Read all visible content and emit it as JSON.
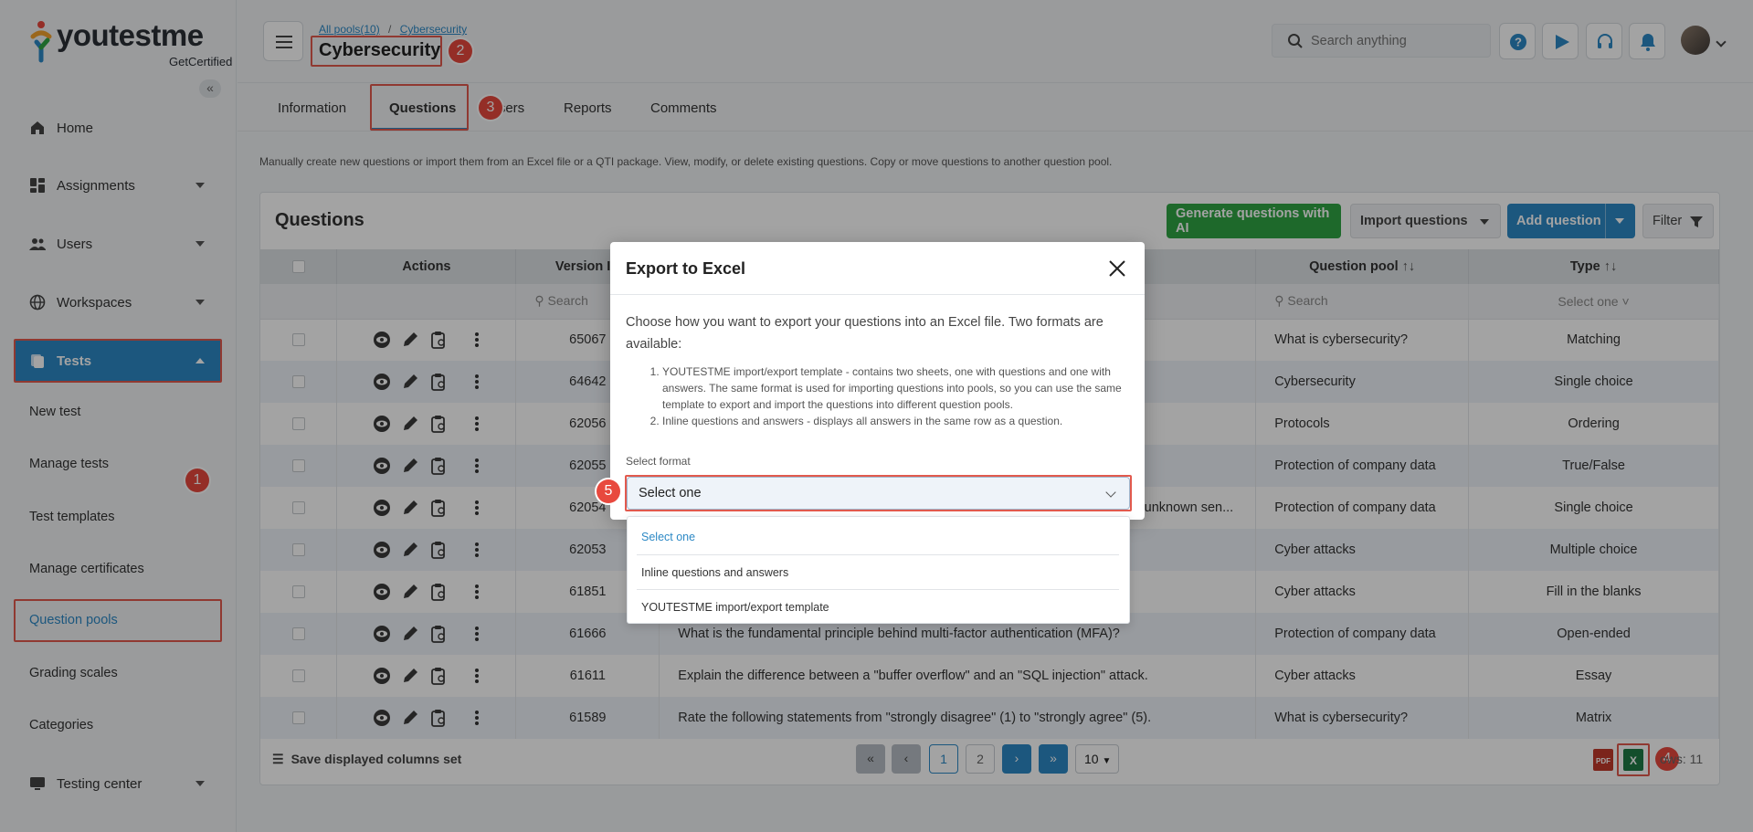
{
  "app": {
    "logo_text": "youtestme",
    "logo_sub": "GetCertified"
  },
  "sidebar": {
    "nav": [
      {
        "label": "Home",
        "icon": "home-icon"
      },
      {
        "label": "Assignments",
        "icon": "dashboard-icon"
      },
      {
        "label": "Users",
        "icon": "users-icon"
      },
      {
        "label": "Workspaces",
        "icon": "globe-icon"
      },
      {
        "label": "Tests",
        "icon": "tests-icon"
      }
    ],
    "sub_items": [
      "New test",
      "Manage tests",
      "Test templates",
      "Manage certificates",
      "Question pools",
      "Grading scales",
      "Categories"
    ],
    "bottom": {
      "label": "Testing center",
      "icon": "monitor-icon"
    }
  },
  "header": {
    "breadcrumb": [
      "All pools(10)",
      "Cybersecurity"
    ],
    "title": "Cybersecurity",
    "search_placeholder": "Search anything"
  },
  "tabs": [
    "Information",
    "Questions",
    "Users",
    "Reports",
    "Comments"
  ],
  "description": "Manually create new questions or import them from an Excel file or a QTI package. View, modify, or delete existing questions. Copy or move questions to another question pool.",
  "card": {
    "title": "Questions",
    "buttons": {
      "generate": "Generate questions with AI",
      "import": "Import questions",
      "add": "Add question",
      "filter": "Filter"
    }
  },
  "table": {
    "headers": [
      "Actions",
      "Version ID",
      "Question pool",
      "Type"
    ],
    "filters": {
      "version_search": "Search",
      "pool_search": "Search",
      "type_select": "Select one"
    },
    "rows": [
      {
        "id": "65067",
        "text": "",
        "pool": "What is cybersecurity?",
        "type": "Matching"
      },
      {
        "id": "64642",
        "text": "",
        "pool": "Cybersecurity",
        "type": "Single choice"
      },
      {
        "id": "62056",
        "text": "",
        "pool": "Protocols",
        "type": "Ordering"
      },
      {
        "id": "62055",
        "text": "",
        "pool": "Protection of company data",
        "type": "True/False"
      },
      {
        "id": "62054",
        "text": "unknown sen...",
        "pool": "Protection of company data",
        "type": "Single choice"
      },
      {
        "id": "62053",
        "text": "",
        "pool": "Cyber attacks",
        "type": "Multiple choice"
      },
      {
        "id": "61851",
        "text": "",
        "pool": "Cyber attacks",
        "type": "Fill in the blanks"
      },
      {
        "id": "61666",
        "text": "What is the fundamental principle behind multi-factor authentication (MFA)?",
        "pool": "Protection of company data",
        "type": "Open-ended"
      },
      {
        "id": "61611",
        "text": "Explain the difference between a \"buffer overflow\" and an \"SQL injection\" attack.",
        "pool": "Cyber attacks",
        "type": "Essay"
      },
      {
        "id": "61589",
        "text": "Rate the following statements from \"strongly disagree\" (1) to \"strongly agree\" (5).",
        "pool": "What is cybersecurity?",
        "type": "Matrix"
      }
    ]
  },
  "footer": {
    "save_columns": "Save displayed columns set",
    "pages": [
      "1",
      "2"
    ],
    "page_size": "10",
    "rows_label": "ows: 11"
  },
  "modal": {
    "title": "Export to Excel",
    "intro": "Choose how you want to export your questions into an Excel file. Two formats are available:",
    "list": [
      "YOUTESTME import/export template - contains two sheets, one with questions and one with answers. The same format is used for importing questions into pools, so you can use the same template to export and import the questions into different question pools.",
      "Inline questions and answers - displays all answers in the same row as a question."
    ],
    "select_label": "Select format",
    "select_value": "Select one",
    "options": [
      "Select one",
      "Inline questions and answers",
      "YOUTESTME import/export template"
    ]
  },
  "annotations": [
    "1",
    "2",
    "3",
    "4",
    "5"
  ],
  "colors": {
    "accent": "#2d89c5",
    "green": "#2fa544",
    "highlight": "#e25a4e"
  }
}
